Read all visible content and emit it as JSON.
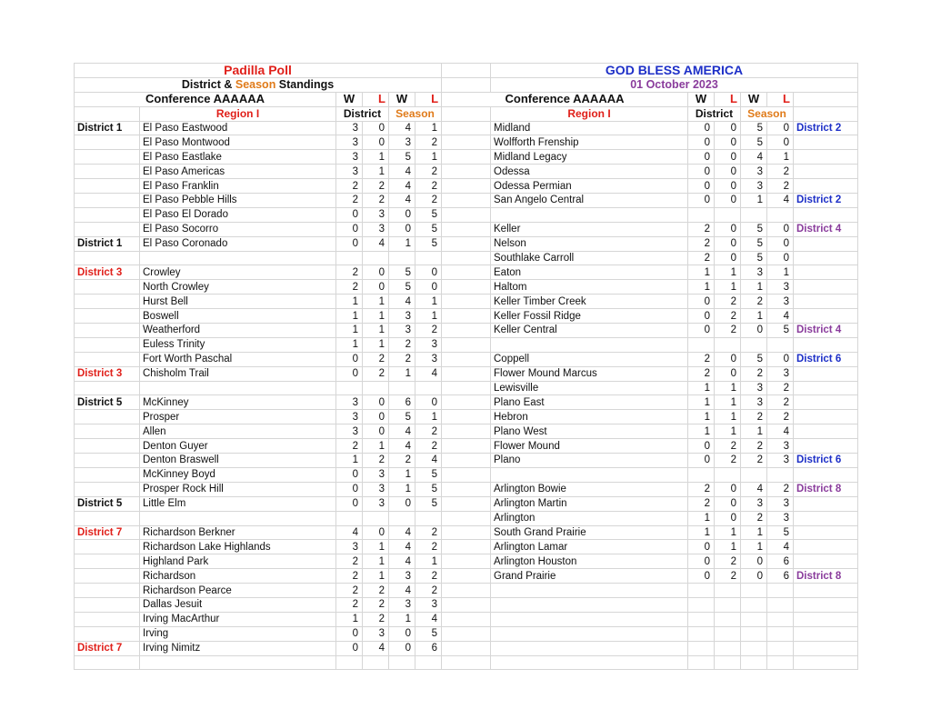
{
  "left": {
    "title": "Padilla Poll",
    "subtitle_parts": [
      "District & ",
      "Season",
      " Standings"
    ],
    "conference": "Conference AAAAAA",
    "col_w": "W",
    "col_l": "L",
    "region": "Region I",
    "district_label": "District",
    "season_label": "Season",
    "rows": [
      {
        "district": "District 1",
        "district_color": "black",
        "team": "El Paso Eastwood",
        "dw": "3",
        "dl": "0",
        "sw": "4",
        "sl": "1"
      },
      {
        "district": "",
        "district_color": "",
        "team": "El Paso Montwood",
        "dw": "3",
        "dl": "0",
        "sw": "3",
        "sl": "2"
      },
      {
        "district": "",
        "district_color": "",
        "team": "El Paso Eastlake",
        "dw": "3",
        "dl": "1",
        "sw": "5",
        "sl": "1"
      },
      {
        "district": "",
        "district_color": "",
        "team": "El Paso Americas",
        "dw": "3",
        "dl": "1",
        "sw": "4",
        "sl": "2"
      },
      {
        "district": "",
        "district_color": "",
        "team": "El Paso Franklin",
        "dw": "2",
        "dl": "2",
        "sw": "4",
        "sl": "2"
      },
      {
        "district": "",
        "district_color": "",
        "team": "El Paso Pebble Hills",
        "dw": "2",
        "dl": "2",
        "sw": "4",
        "sl": "2"
      },
      {
        "district": "",
        "district_color": "",
        "team": "El Paso El Dorado",
        "dw": "0",
        "dl": "3",
        "sw": "0",
        "sl": "5"
      },
      {
        "district": "",
        "district_color": "",
        "team": "El Paso Socorro",
        "dw": "0",
        "dl": "3",
        "sw": "0",
        "sl": "5"
      },
      {
        "district": "District 1",
        "district_color": "black",
        "team": "El Paso Coronado",
        "dw": "0",
        "dl": "4",
        "sw": "1",
        "sl": "5"
      },
      {
        "district": "",
        "district_color": "",
        "team": "",
        "dw": "",
        "dl": "",
        "sw": "",
        "sl": ""
      },
      {
        "district": "District 3",
        "district_color": "red",
        "team": "Crowley",
        "dw": "2",
        "dl": "0",
        "sw": "5",
        "sl": "0"
      },
      {
        "district": "",
        "district_color": "",
        "team": "North Crowley",
        "dw": "2",
        "dl": "0",
        "sw": "5",
        "sl": "0"
      },
      {
        "district": "",
        "district_color": "",
        "team": "Hurst Bell",
        "dw": "1",
        "dl": "1",
        "sw": "4",
        "sl": "1"
      },
      {
        "district": "",
        "district_color": "",
        "team": "Boswell",
        "dw": "1",
        "dl": "1",
        "sw": "3",
        "sl": "1"
      },
      {
        "district": "",
        "district_color": "",
        "team": "Weatherford",
        "dw": "1",
        "dl": "1",
        "sw": "3",
        "sl": "2"
      },
      {
        "district": "",
        "district_color": "",
        "team": "Euless Trinity",
        "dw": "1",
        "dl": "1",
        "sw": "2",
        "sl": "3"
      },
      {
        "district": "",
        "district_color": "",
        "team": "Fort Worth Paschal",
        "dw": "0",
        "dl": "2",
        "sw": "2",
        "sl": "3"
      },
      {
        "district": "District 3",
        "district_color": "red",
        "team": "Chisholm Trail",
        "dw": "0",
        "dl": "2",
        "sw": "1",
        "sl": "4"
      },
      {
        "district": "",
        "district_color": "",
        "team": "",
        "dw": "",
        "dl": "",
        "sw": "",
        "sl": ""
      },
      {
        "district": "District 5",
        "district_color": "black",
        "team": "McKinney",
        "dw": "3",
        "dl": "0",
        "sw": "6",
        "sl": "0"
      },
      {
        "district": "",
        "district_color": "",
        "team": "Prosper",
        "dw": "3",
        "dl": "0",
        "sw": "5",
        "sl": "1"
      },
      {
        "district": "",
        "district_color": "",
        "team": "Allen",
        "dw": "3",
        "dl": "0",
        "sw": "4",
        "sl": "2"
      },
      {
        "district": "",
        "district_color": "",
        "team": "Denton Guyer",
        "dw": "2",
        "dl": "1",
        "sw": "4",
        "sl": "2"
      },
      {
        "district": "",
        "district_color": "",
        "team": "Denton Braswell",
        "dw": "1",
        "dl": "2",
        "sw": "2",
        "sl": "4"
      },
      {
        "district": "",
        "district_color": "",
        "team": "McKinney Boyd",
        "dw": "0",
        "dl": "3",
        "sw": "1",
        "sl": "5"
      },
      {
        "district": "",
        "district_color": "",
        "team": "Prosper Rock Hill",
        "dw": "0",
        "dl": "3",
        "sw": "1",
        "sl": "5"
      },
      {
        "district": "District 5",
        "district_color": "black",
        "team": "Little Elm",
        "dw": "0",
        "dl": "3",
        "sw": "0",
        "sl": "5"
      },
      {
        "district": "",
        "district_color": "",
        "team": "",
        "dw": "",
        "dl": "",
        "sw": "",
        "sl": ""
      },
      {
        "district": "District 7",
        "district_color": "red",
        "team": "Richardson Berkner",
        "dw": "4",
        "dl": "0",
        "sw": "4",
        "sl": "2"
      },
      {
        "district": "",
        "district_color": "",
        "team": "Richardson Lake Highlands",
        "dw": "3",
        "dl": "1",
        "sw": "4",
        "sl": "2"
      },
      {
        "district": "",
        "district_color": "",
        "team": "Highland Park",
        "dw": "2",
        "dl": "1",
        "sw": "4",
        "sl": "1"
      },
      {
        "district": "",
        "district_color": "",
        "team": "Richardson",
        "dw": "2",
        "dl": "1",
        "sw": "3",
        "sl": "2"
      },
      {
        "district": "",
        "district_color": "",
        "team": "Richardson Pearce",
        "dw": "2",
        "dl": "2",
        "sw": "4",
        "sl": "2"
      },
      {
        "district": "",
        "district_color": "",
        "team": "Dallas Jesuit",
        "dw": "2",
        "dl": "2",
        "sw": "3",
        "sl": "3"
      },
      {
        "district": "",
        "district_color": "",
        "team": "Irving MacArthur",
        "dw": "1",
        "dl": "2",
        "sw": "1",
        "sl": "4"
      },
      {
        "district": "",
        "district_color": "",
        "team": "Irving",
        "dw": "0",
        "dl": "3",
        "sw": "0",
        "sl": "5"
      },
      {
        "district": "District 7",
        "district_color": "red",
        "team": "Irving Nimitz",
        "dw": "0",
        "dl": "4",
        "sw": "0",
        "sl": "6"
      },
      {
        "district": "",
        "district_color": "",
        "team": "",
        "dw": "",
        "dl": "",
        "sw": "",
        "sl": ""
      }
    ]
  },
  "right": {
    "title": "GOD BLESS AMERICA",
    "date": "01 October 2023",
    "conference": "Conference AAAAAA",
    "col_w": "W",
    "col_l": "L",
    "region": "Region I",
    "district_label": "District",
    "season_label": "Season",
    "rows": [
      {
        "team": "Midland",
        "dw": "0",
        "dl": "0",
        "sw": "5",
        "sl": "0",
        "district": "District 2",
        "district_color": "blue"
      },
      {
        "team": "Wolfforth Frenship",
        "dw": "0",
        "dl": "0",
        "sw": "5",
        "sl": "0",
        "district": "",
        "district_color": ""
      },
      {
        "team": "Midland Legacy",
        "dw": "0",
        "dl": "0",
        "sw": "4",
        "sl": "1",
        "district": "",
        "district_color": ""
      },
      {
        "team": "Odessa",
        "dw": "0",
        "dl": "0",
        "sw": "3",
        "sl": "2",
        "district": "",
        "district_color": ""
      },
      {
        "team": "Odessa Permian",
        "dw": "0",
        "dl": "0",
        "sw": "3",
        "sl": "2",
        "district": "",
        "district_color": ""
      },
      {
        "team": "San Angelo Central",
        "dw": "0",
        "dl": "0",
        "sw": "1",
        "sl": "4",
        "district": "District 2",
        "district_color": "blue"
      },
      {
        "team": "",
        "dw": "",
        "dl": "",
        "sw": "",
        "sl": "",
        "district": "",
        "district_color": ""
      },
      {
        "team": "Keller",
        "dw": "2",
        "dl": "0",
        "sw": "5",
        "sl": "0",
        "district": "District 4",
        "district_color": "purple"
      },
      {
        "team": "Nelson",
        "dw": "2",
        "dl": "0",
        "sw": "5",
        "sl": "0",
        "district": "",
        "district_color": ""
      },
      {
        "team": "Southlake Carroll",
        "dw": "2",
        "dl": "0",
        "sw": "5",
        "sl": "0",
        "district": "",
        "district_color": ""
      },
      {
        "team": "Eaton",
        "dw": "1",
        "dl": "1",
        "sw": "3",
        "sl": "1",
        "district": "",
        "district_color": ""
      },
      {
        "team": "Haltom",
        "dw": "1",
        "dl": "1",
        "sw": "1",
        "sl": "3",
        "district": "",
        "district_color": ""
      },
      {
        "team": "Keller Timber Creek",
        "dw": "0",
        "dl": "2",
        "sw": "2",
        "sl": "3",
        "district": "",
        "district_color": ""
      },
      {
        "team": "Keller Fossil Ridge",
        "dw": "0",
        "dl": "2",
        "sw": "1",
        "sl": "4",
        "district": "",
        "district_color": ""
      },
      {
        "team": "Keller Central",
        "dw": "0",
        "dl": "2",
        "sw": "0",
        "sl": "5",
        "district": "District 4",
        "district_color": "purple"
      },
      {
        "team": "",
        "dw": "",
        "dl": "",
        "sw": "",
        "sl": "",
        "district": "",
        "district_color": ""
      },
      {
        "team": "Coppell",
        "dw": "2",
        "dl": "0",
        "sw": "5",
        "sl": "0",
        "district": "District 6",
        "district_color": "blue"
      },
      {
        "team": "Flower Mound Marcus",
        "dw": "2",
        "dl": "0",
        "sw": "2",
        "sl": "3",
        "district": "",
        "district_color": ""
      },
      {
        "team": "Lewisville",
        "dw": "1",
        "dl": "1",
        "sw": "3",
        "sl": "2",
        "district": "",
        "district_color": ""
      },
      {
        "team": "Plano East",
        "dw": "1",
        "dl": "1",
        "sw": "3",
        "sl": "2",
        "district": "",
        "district_color": ""
      },
      {
        "team": "Hebron",
        "dw": "1",
        "dl": "1",
        "sw": "2",
        "sl": "2",
        "district": "",
        "district_color": ""
      },
      {
        "team": "Plano West",
        "dw": "1",
        "dl": "1",
        "sw": "1",
        "sl": "4",
        "district": "",
        "district_color": ""
      },
      {
        "team": "Flower Mound",
        "dw": "0",
        "dl": "2",
        "sw": "2",
        "sl": "3",
        "district": "",
        "district_color": ""
      },
      {
        "team": "Plano",
        "dw": "0",
        "dl": "2",
        "sw": "2",
        "sl": "3",
        "district": "District 6",
        "district_color": "blue"
      },
      {
        "team": "",
        "dw": "",
        "dl": "",
        "sw": "",
        "sl": "",
        "district": "",
        "district_color": ""
      },
      {
        "team": "Arlington Bowie",
        "dw": "2",
        "dl": "0",
        "sw": "4",
        "sl": "2",
        "district": "District 8",
        "district_color": "purple"
      },
      {
        "team": "Arlington Martin",
        "dw": "2",
        "dl": "0",
        "sw": "3",
        "sl": "3",
        "district": "",
        "district_color": ""
      },
      {
        "team": "Arlington",
        "dw": "1",
        "dl": "0",
        "sw": "2",
        "sl": "3",
        "district": "",
        "district_color": ""
      },
      {
        "team": "South Grand Prairie",
        "dw": "1",
        "dl": "1",
        "sw": "1",
        "sl": "5",
        "district": "",
        "district_color": ""
      },
      {
        "team": "Arlington Lamar",
        "dw": "0",
        "dl": "1",
        "sw": "1",
        "sl": "4",
        "district": "",
        "district_color": ""
      },
      {
        "team": "Arlington Houston",
        "dw": "0",
        "dl": "2",
        "sw": "0",
        "sl": "6",
        "district": "",
        "district_color": ""
      },
      {
        "team": "Grand Prairie",
        "dw": "0",
        "dl": "2",
        "sw": "0",
        "sl": "6",
        "district": "District 8",
        "district_color": "purple"
      },
      {
        "team": "",
        "dw": "",
        "dl": "",
        "sw": "",
        "sl": "",
        "district": "",
        "district_color": ""
      },
      {
        "team": "",
        "dw": "",
        "dl": "",
        "sw": "",
        "sl": "",
        "district": "",
        "district_color": ""
      },
      {
        "team": "",
        "dw": "",
        "dl": "",
        "sw": "",
        "sl": "",
        "district": "",
        "district_color": ""
      },
      {
        "team": "",
        "dw": "",
        "dl": "",
        "sw": "",
        "sl": "",
        "district": "",
        "district_color": ""
      },
      {
        "team": "",
        "dw": "",
        "dl": "",
        "sw": "",
        "sl": "",
        "district": "",
        "district_color": ""
      },
      {
        "team": "",
        "dw": "",
        "dl": "",
        "sw": "",
        "sl": "",
        "district": "",
        "district_color": ""
      }
    ]
  }
}
